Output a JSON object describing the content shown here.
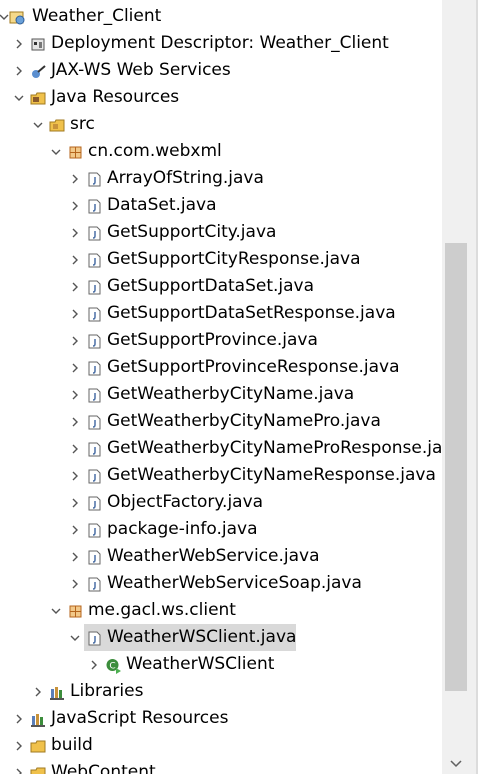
{
  "tree": {
    "rows": [
      {
        "label": "Weather_Client",
        "icon": "web-project-icon",
        "twisty": "expanded"
      },
      {
        "label": "Deployment Descriptor: Weather_Client",
        "icon": "deployment-descriptor-icon",
        "twisty": "collapsed"
      },
      {
        "label": "JAX-WS Web Services",
        "icon": "web-services-icon",
        "twisty": "collapsed"
      },
      {
        "label": "Java Resources",
        "icon": "java-resources-icon",
        "twisty": "expanded"
      },
      {
        "label": "src",
        "icon": "source-folder-icon",
        "twisty": "expanded"
      },
      {
        "label": "cn.com.webxml",
        "icon": "package-icon",
        "twisty": "expanded"
      },
      {
        "label": "ArrayOfString.java",
        "icon": "java-file-icon",
        "twisty": "collapsed"
      },
      {
        "label": "DataSet.java",
        "icon": "java-file-icon",
        "twisty": "collapsed"
      },
      {
        "label": "GetSupportCity.java",
        "icon": "java-file-icon",
        "twisty": "collapsed"
      },
      {
        "label": "GetSupportCityResponse.java",
        "icon": "java-file-icon",
        "twisty": "collapsed"
      },
      {
        "label": "GetSupportDataSet.java",
        "icon": "java-file-icon",
        "twisty": "collapsed"
      },
      {
        "label": "GetSupportDataSetResponse.java",
        "icon": "java-file-icon",
        "twisty": "collapsed"
      },
      {
        "label": "GetSupportProvince.java",
        "icon": "java-file-icon",
        "twisty": "collapsed"
      },
      {
        "label": "GetSupportProvinceResponse.java",
        "icon": "java-file-icon",
        "twisty": "collapsed"
      },
      {
        "label": "GetWeatherbyCityName.java",
        "icon": "java-file-icon",
        "twisty": "collapsed"
      },
      {
        "label": "GetWeatherbyCityNamePro.java",
        "icon": "java-file-icon",
        "twisty": "collapsed"
      },
      {
        "label": "GetWeatherbyCityNameProResponse.ja",
        "icon": "java-file-icon",
        "twisty": "collapsed"
      },
      {
        "label": "GetWeatherbyCityNameResponse.java",
        "icon": "java-file-icon",
        "twisty": "collapsed"
      },
      {
        "label": "ObjectFactory.java",
        "icon": "java-file-icon",
        "twisty": "collapsed"
      },
      {
        "label": "package-info.java",
        "icon": "java-file-icon",
        "twisty": "collapsed"
      },
      {
        "label": "WeatherWebService.java",
        "icon": "java-file-icon",
        "twisty": "collapsed"
      },
      {
        "label": "WeatherWebServiceSoap.java",
        "icon": "java-file-icon",
        "twisty": "collapsed"
      },
      {
        "label": "me.gacl.ws.client",
        "icon": "package-icon",
        "twisty": "expanded"
      },
      {
        "label": "WeatherWSClient.java",
        "icon": "java-file-icon",
        "twisty": "expanded",
        "selected": true
      },
      {
        "label": "WeatherWSClient",
        "icon": "java-class-icon",
        "twisty": "collapsed"
      },
      {
        "label": "Libraries",
        "icon": "libraries-icon",
        "twisty": "collapsed"
      },
      {
        "label": "JavaScript Resources",
        "icon": "javascript-resources-icon",
        "twisty": "collapsed"
      },
      {
        "label": "build",
        "icon": "folder-icon",
        "twisty": "collapsed"
      },
      {
        "label": "WebContent",
        "icon": "folder-icon",
        "twisty": "collapsed"
      }
    ]
  },
  "colors": {
    "selection": "#d9d9d9",
    "package": "#b5651d",
    "java_file": "#4a6fa5",
    "folder": "#e8b44a",
    "class_green": "#3c8d3c"
  }
}
